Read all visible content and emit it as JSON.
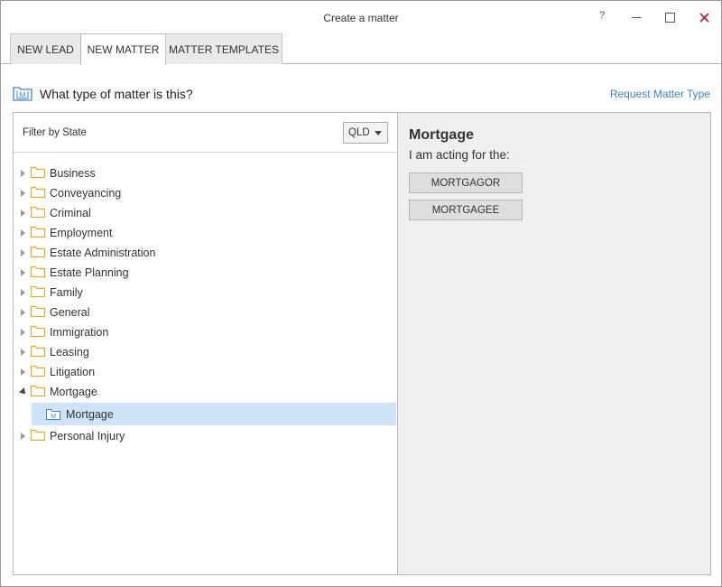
{
  "window": {
    "title": "Create a matter",
    "help": "?",
    "minimize": "–",
    "maximize": "□",
    "close": "✕"
  },
  "tabs": [
    {
      "label": "NEW LEAD"
    },
    {
      "label": "NEW MATTER"
    },
    {
      "label": "MATTER TEMPLATES"
    }
  ],
  "active_tab": "NEW MATTER",
  "header": {
    "question": "What type of matter is this?",
    "request_link": "Request Matter Type",
    "icon": "matter-type-icon"
  },
  "filter": {
    "label": "Filter by State",
    "selected_state": "QLD"
  },
  "tree": {
    "items": [
      {
        "label": "Business"
      },
      {
        "label": "Conveyancing"
      },
      {
        "label": "Criminal"
      },
      {
        "label": "Employment"
      },
      {
        "label": "Estate Administration"
      },
      {
        "label": "Estate Planning"
      },
      {
        "label": "Family"
      },
      {
        "label": "General"
      },
      {
        "label": "Immigration"
      },
      {
        "label": "Leasing"
      },
      {
        "label": "Litigation"
      },
      {
        "label": "Mortgage",
        "expanded": true
      },
      {
        "label": "Personal Injury"
      }
    ],
    "selected_child": {
      "parent": "Mortgage",
      "label": "Mortgage"
    }
  },
  "detail": {
    "title": "Mortgage",
    "subtitle": "I am acting for the:",
    "buttons": [
      {
        "label": "MORTGAGOR"
      },
      {
        "label": "MORTGAGEE"
      }
    ]
  },
  "colors": {
    "folder": "#f2a51c",
    "link": "#3d86c6",
    "selection": "#cde3f7",
    "close": "#c8102e"
  }
}
